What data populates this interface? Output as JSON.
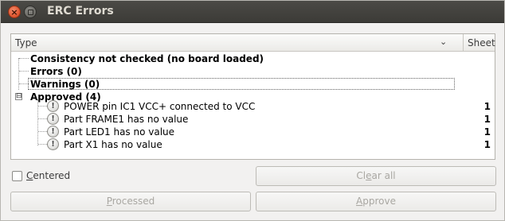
{
  "window": {
    "title": "ERC Errors",
    "close_icon": "close-icon",
    "minimize_icon": "minimize-icon"
  },
  "tree": {
    "columns": {
      "type": "Type",
      "sheet": "Sheet"
    },
    "groups": [
      {
        "label": "Consistency not checked (no board loaded)"
      },
      {
        "label": "Errors (0)"
      },
      {
        "label": "Warnings (0)"
      },
      {
        "label": "Approved (4)",
        "expander": "⊟",
        "items": [
          {
            "label": "POWER pin IC1 VCC+ connected to VCC",
            "sheet": "1",
            "icon": "!"
          },
          {
            "label": "Part FRAME1 has no value",
            "sheet": "1",
            "icon": "!"
          },
          {
            "label": "Part LED1 has no value",
            "sheet": "1",
            "icon": "!"
          },
          {
            "label": "Part X1 has no value",
            "sheet": "1",
            "icon": "!"
          }
        ]
      }
    ]
  },
  "controls": {
    "centered": {
      "label_u": "C",
      "label_rest": "entered",
      "checked": false
    },
    "clear_all": {
      "label_pre": "Cl",
      "label_u": "e",
      "label_rest": "ar all"
    },
    "processed": {
      "label_u": "P",
      "label_rest": "rocessed"
    },
    "approve": {
      "label_u": "A",
      "label_rest": "pprove"
    }
  }
}
